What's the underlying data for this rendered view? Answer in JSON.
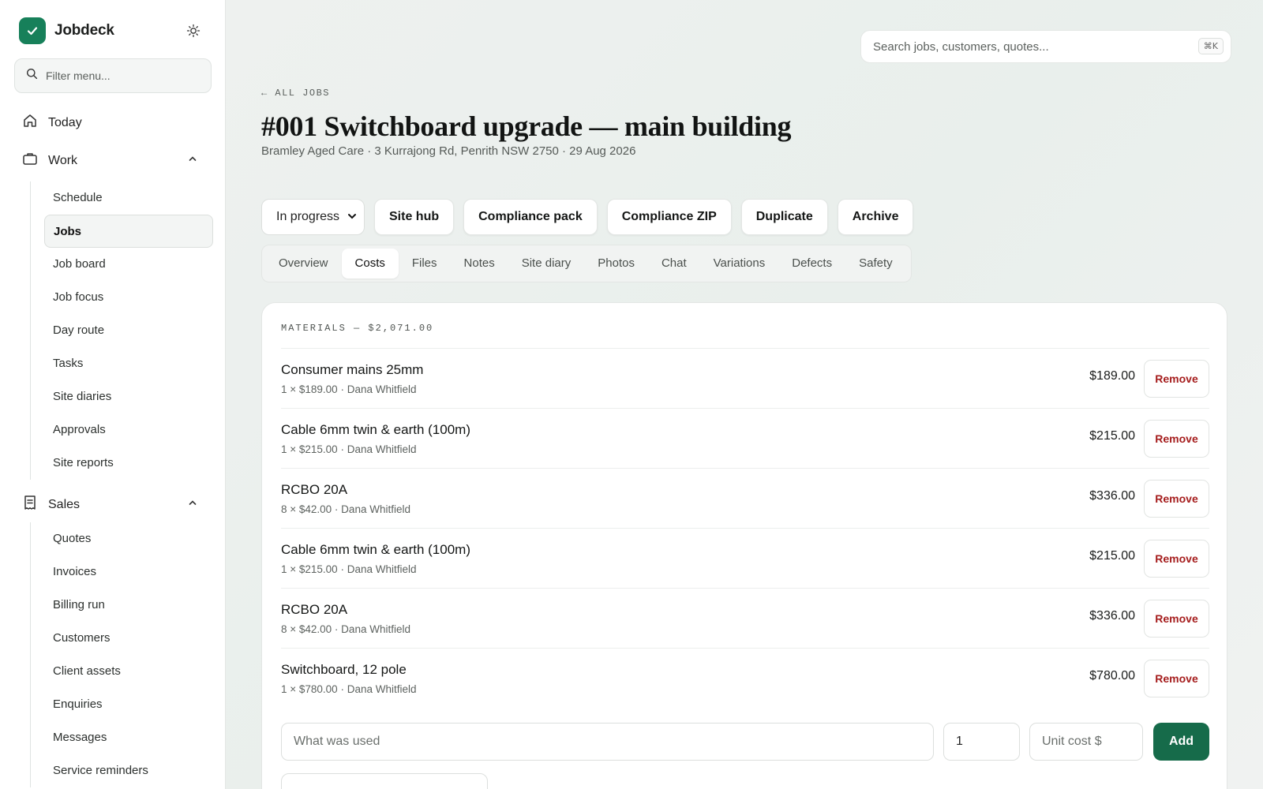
{
  "app": {
    "name": "Jobdeck"
  },
  "sidebar": {
    "filter_placeholder": "Filter menu...",
    "today": "Today",
    "work": {
      "label": "Work",
      "items": [
        "Schedule",
        "Jobs",
        "Job board",
        "Job focus",
        "Day route",
        "Tasks",
        "Site diaries",
        "Approvals",
        "Site reports"
      ],
      "active": "Jobs"
    },
    "sales": {
      "label": "Sales",
      "items": [
        "Quotes",
        "Invoices",
        "Billing run",
        "Customers",
        "Client assets",
        "Enquiries",
        "Messages",
        "Service reminders"
      ]
    }
  },
  "search": {
    "placeholder": "Search jobs, customers, quotes...",
    "shortcut": "⌘K"
  },
  "header": {
    "back": "← ALL JOBS",
    "title": "#001 Switchboard upgrade — main building",
    "subtitle": "Bramley Aged Care · 3 Kurrajong Rd, Penrith NSW 2750 · 29 Aug 2026"
  },
  "actions": {
    "status": "In progress",
    "buttons": [
      "Site hub",
      "Compliance pack",
      "Compliance ZIP",
      "Duplicate",
      "Archive"
    ]
  },
  "tabs": {
    "items": [
      "Overview",
      "Costs",
      "Files",
      "Notes",
      "Site diary",
      "Photos",
      "Chat",
      "Variations",
      "Defects",
      "Safety"
    ],
    "active": "Costs"
  },
  "materials": {
    "title": "MATERIALS — $2,071.00",
    "items": [
      {
        "name": "Consumer mains 25mm",
        "meta": "1 × $189.00 · Dana Whitfield",
        "amount": "$189.00"
      },
      {
        "name": "Cable 6mm twin & earth (100m)",
        "meta": "1 × $215.00 · Dana Whitfield",
        "amount": "$215.00"
      },
      {
        "name": "RCBO 20A",
        "meta": "8 × $42.00 · Dana Whitfield",
        "amount": "$336.00"
      },
      {
        "name": "Cable 6mm twin & earth (100m)",
        "meta": "1 × $215.00 · Dana Whitfield",
        "amount": "$215.00"
      },
      {
        "name": "RCBO 20A",
        "meta": "8 × $42.00 · Dana Whitfield",
        "amount": "$336.00"
      },
      {
        "name": "Switchboard, 12 pole",
        "meta": "1 × $780.00 · Dana Whitfield",
        "amount": "$780.00"
      }
    ],
    "remove_label": "Remove",
    "add_form": {
      "what_placeholder": "What was used",
      "qty_value": "1",
      "unit_cost_placeholder": "Unit cost $",
      "add_label": "Add"
    }
  },
  "colors": {
    "accent": "#166b4a",
    "danger": "#a51d1d",
    "brand": "#17805a"
  }
}
